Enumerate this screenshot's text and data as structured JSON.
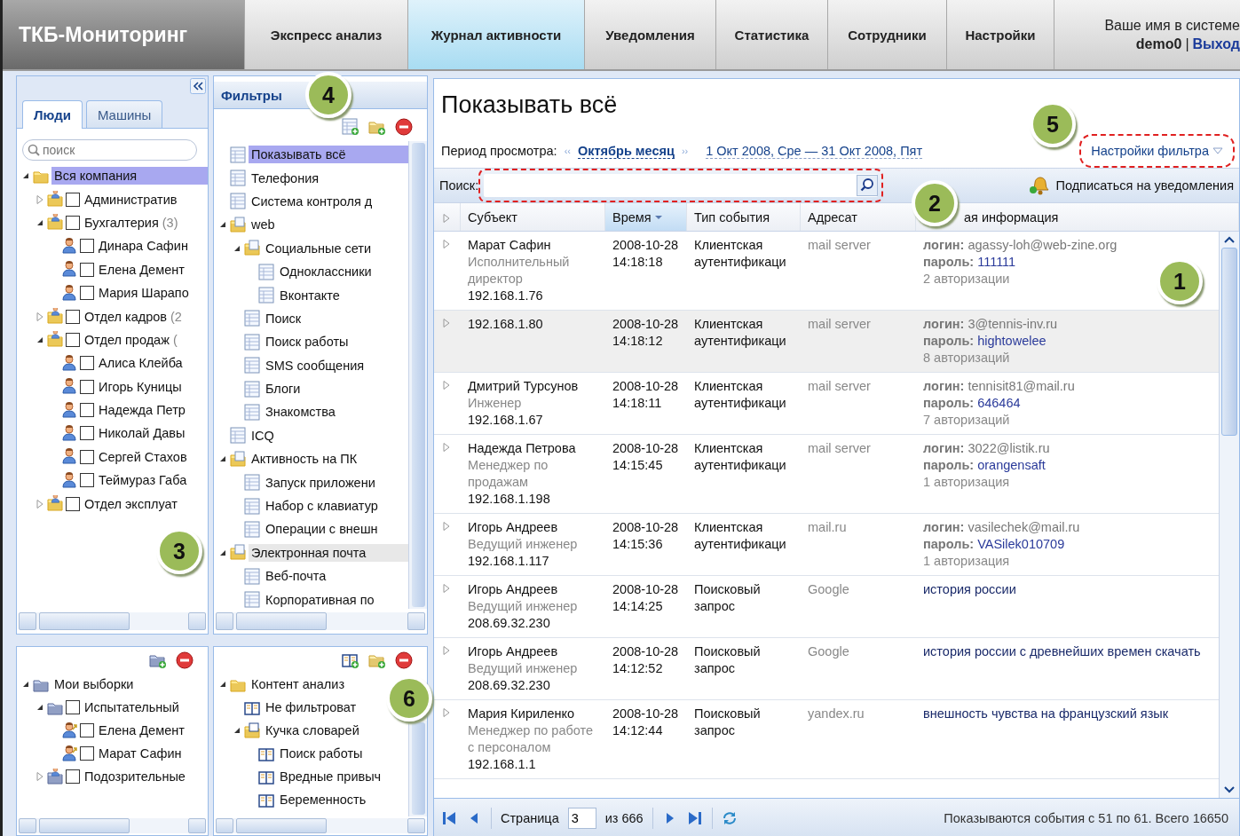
{
  "header": {
    "logo": "ТКБ-Мониторинг",
    "nav": [
      {
        "label": "Экспресс анализ",
        "selected": false
      },
      {
        "label": "Журнал активности",
        "selected": true
      },
      {
        "label": "Уведомления",
        "selected": false
      },
      {
        "label": "Статистика",
        "selected": false
      },
      {
        "label": "Сотрудники",
        "selected": false
      },
      {
        "label": "Настройки",
        "selected": false
      }
    ],
    "user_label": "Ваше имя в системе",
    "user_name": "demo0",
    "separator": "|",
    "logout": "Выход"
  },
  "people_panel": {
    "tabs": [
      {
        "label": "Люди",
        "selected": true
      },
      {
        "label": "Машины",
        "selected": false
      }
    ],
    "search": {
      "placeholder": "поиск"
    },
    "tree": [
      {
        "label": "Вся компания",
        "kind": "folder",
        "expanded": true,
        "selected": true,
        "children": [
          {
            "label": "Административ",
            "kind": "group",
            "expanded": false,
            "checked": false,
            "selected": false
          },
          {
            "label": "Бухгалтерия",
            "count": "(3)",
            "kind": "group",
            "expanded": true,
            "checked": false,
            "selected": false,
            "children": [
              {
                "label": "Динара Сафин",
                "kind": "person",
                "checked": false,
                "selected": false
              },
              {
                "label": "Елена Демент",
                "kind": "person",
                "checked": false,
                "selected": false
              },
              {
                "label": "Мария Шарапо",
                "kind": "person",
                "checked": false,
                "selected": false
              }
            ]
          },
          {
            "label": "Отдел кадров",
            "count": "(2",
            "kind": "group",
            "expanded": false,
            "checked": false,
            "selected": false
          },
          {
            "label": "Отдел продаж",
            "count": "(",
            "kind": "group",
            "expanded": true,
            "checked": false,
            "selected": false,
            "children": [
              {
                "label": "Алиса Клейба",
                "kind": "person",
                "checked": false,
                "selected": false
              },
              {
                "label": "Игорь Куницы",
                "kind": "person",
                "checked": false,
                "selected": false
              },
              {
                "label": "Надежда Петр",
                "kind": "person",
                "checked": false,
                "selected": false
              },
              {
                "label": "Николай Давы",
                "kind": "person",
                "checked": false,
                "selected": false
              },
              {
                "label": "Сергей Стахов",
                "kind": "person",
                "checked": false,
                "selected": false
              },
              {
                "label": "Теймураз Габа",
                "kind": "person",
                "checked": false,
                "selected": false
              }
            ]
          },
          {
            "label": "Отдел эксплуат",
            "kind": "group",
            "expanded": false,
            "checked": false,
            "selected": false
          }
        ]
      }
    ]
  },
  "selections_panel": {
    "toolbar": [
      {
        "kind": "add-group"
      },
      {
        "kind": "delete"
      }
    ],
    "tree": [
      {
        "label": "Мои выборки",
        "kind": "blue-folder",
        "expanded": true,
        "children": [
          {
            "label": "Испытательный",
            "kind": "blue-folder",
            "expanded": true,
            "checked": false,
            "children": [
              {
                "label": "Елена Демент",
                "kind": "person-link",
                "checked": false
              },
              {
                "label": "Марат Сафин",
                "kind": "person-link",
                "checked": false
              }
            ]
          },
          {
            "label": "Подозрительные",
            "kind": "blue-group",
            "expanded": false,
            "checked": false
          }
        ]
      }
    ]
  },
  "filters_panel": {
    "title": "Фильтры",
    "toolbar": [
      {
        "kind": "add-table"
      },
      {
        "kind": "add-folder"
      },
      {
        "kind": "delete"
      }
    ],
    "tree": [
      {
        "label": "Показывать всё",
        "kind": "table",
        "selected": true
      },
      {
        "label": "Телефония",
        "kind": "table",
        "selected": false
      },
      {
        "label": "Система контроля д",
        "kind": "table",
        "selected": false
      },
      {
        "label": "web",
        "kind": "table-folder",
        "expanded": true,
        "selected": false,
        "children": [
          {
            "label": "Социальные сети",
            "kind": "table-folder",
            "expanded": true,
            "selected": false,
            "children": [
              {
                "label": "Одноклассники",
                "kind": "table",
                "selected": false
              },
              {
                "label": "Вконтакте",
                "kind": "table",
                "selected": false
              }
            ]
          },
          {
            "label": "Поиск",
            "kind": "table",
            "selected": false
          },
          {
            "label": "Поиск работы",
            "kind": "table",
            "selected": false
          },
          {
            "label": "SMS сообщения",
            "kind": "table",
            "selected": false
          },
          {
            "label": "Блоги",
            "kind": "table",
            "selected": false
          },
          {
            "label": "Знакомства",
            "kind": "table",
            "selected": false
          }
        ]
      },
      {
        "label": "ICQ",
        "kind": "table",
        "selected": false
      },
      {
        "label": "Активность на ПК",
        "kind": "table-folder",
        "expanded": true,
        "selected": false,
        "children": [
          {
            "label": "Запуск приложени",
            "kind": "table",
            "selected": false
          },
          {
            "label": "Набор с клавиатур",
            "kind": "table",
            "selected": false
          },
          {
            "label": "Операции с внешн",
            "kind": "table",
            "selected": false
          }
        ]
      },
      {
        "label": "Электронная почта",
        "kind": "table-folder",
        "expanded": true,
        "selected": false,
        "hover": true,
        "children": [
          {
            "label": "Веб-почта",
            "kind": "table",
            "selected": false
          },
          {
            "label": "Корпоративная по",
            "kind": "table",
            "selected": false
          }
        ]
      }
    ]
  },
  "content_panel": {
    "toolbar": [
      {
        "kind": "add-book"
      },
      {
        "kind": "add-folder"
      },
      {
        "kind": "delete"
      }
    ],
    "tree": [
      {
        "label": "Контент анализ",
        "kind": "folder",
        "expanded": true,
        "children": [
          {
            "label": "Не фильтроват",
            "kind": "book"
          },
          {
            "label": "Кучка словарей",
            "kind": "book-folder",
            "expanded": true,
            "children": [
              {
                "label": "Поиск работы",
                "kind": "book"
              },
              {
                "label": "Вредные привыч",
                "kind": "book"
              },
              {
                "label": "Беременность",
                "kind": "book"
              }
            ]
          }
        ]
      }
    ]
  },
  "main": {
    "title": "Показывать всё",
    "period_label": "Период просмотра:",
    "period_prev": "‹‹",
    "period_value": "Октябрь месяц",
    "period_next": "››",
    "date_range": "1 Окт 2008, Сре — 31 Окт 2008, Пят",
    "filter_settings": "Настройки фильтра",
    "search_label": "Поиск:",
    "subscribe": "Подписаться на уведомления",
    "columns": [
      {
        "label": "Субъект",
        "sorted": false
      },
      {
        "label": "Время",
        "sorted": true
      },
      {
        "label": "Тип события",
        "sorted": false
      },
      {
        "label": "Адресат",
        "sorted": false
      },
      {
        "label": "ая информация",
        "sorted": false
      }
    ],
    "rows": [
      {
        "kind": "auth",
        "selected": false,
        "expanded": false,
        "subject": "Марат Сафин",
        "role": "Исполнительный директор",
        "ip": "192.168.1.76",
        "time": "2008-10-28 14:18:18",
        "event": "Клиентская аутентификаци",
        "recipient": "mail server",
        "login": "**логин:** agassy-loh@web-zine.org",
        "password": "**пароль:** 111111",
        "count": "2 авторизации"
      },
      {
        "kind": "auth",
        "selected": true,
        "expanded": false,
        "subject": "192.168.1.80",
        "time": "2008-10-28 14:18:12",
        "event": "Клиентская аутентификаци",
        "recipient": "mail server",
        "login": "**логин:** 3@tennis-inv.ru",
        "password": "**пароль:** hightowelee",
        "count": "8 авторизаций"
      },
      {
        "kind": "auth",
        "selected": false,
        "expanded": false,
        "subject": "Дмитрий Турсунов",
        "role": "Инженер",
        "ip": "192.168.1.67",
        "time": "2008-10-28 14:18:11",
        "event": "Клиентская аутентификаци",
        "recipient": "mail server",
        "login": "**логин:** tennisit81@mail.ru",
        "password": "**пароль:** 646464",
        "count": "7 авторизаций"
      },
      {
        "kind": "auth",
        "selected": false,
        "expanded": false,
        "subject": "Надежда Петрова",
        "role": "Менеджер по продажам",
        "ip": "192.168.1.198",
        "time": "2008-10-28 14:15:45",
        "event": "Клиентская аутентификаци",
        "recipient": "mail server",
        "login": "**логин:** 3022@listik.ru",
        "password": "**пароль:** orangensaft",
        "count": "1 авторизация"
      },
      {
        "kind": "auth",
        "selected": false,
        "expanded": false,
        "subject": "Игорь Андреев",
        "role": "Ведущий инженер",
        "ip": "192.168.1.117",
        "time": "2008-10-28 14:15:36",
        "event": "Клиентская аутентификаци",
        "recipient": "mail.ru",
        "login": "**логин:** vasilechek@mail.ru",
        "password": "**пароль:** VASilek010709",
        "count": "1 авторизация"
      },
      {
        "kind": "query",
        "selected": false,
        "expanded": false,
        "subject": "Игорь Андреев",
        "role": "Ведущий инженер",
        "ip": "208.69.32.230",
        "time": "2008-10-28 14:14:25",
        "event": "Поисковый запрос",
        "recipient": "Google",
        "query": "история россии"
      },
      {
        "kind": "query",
        "selected": false,
        "expanded": false,
        "subject": "Игорь Андреев",
        "role": "Ведущий инженер",
        "ip": "208.69.32.230",
        "time": "2008-10-28 14:12:52",
        "event": "Поисковый запрос",
        "recipient": "Google",
        "query": "история россии с древнейших времен скачать"
      },
      {
        "kind": "query",
        "selected": false,
        "expanded": false,
        "subject": "Мария Кириленко",
        "role": "Менеджер по работе с персоналом",
        "ip": "192.168.1.1",
        "time": "2008-10-28 14:12:44",
        "event": "Поисковый запрос",
        "recipient": "yandex.ru",
        "query": "внешность чувства на французский язык"
      }
    ],
    "pager": {
      "page_label": "Страница",
      "page": "3",
      "of": "из 666",
      "status": "Показываются события с 51 по 61. Всего 16650"
    }
  },
  "callouts": [
    {
      "label": "4"
    },
    {
      "label": "5"
    },
    {
      "label": "2"
    },
    {
      "label": "1"
    },
    {
      "label": "3"
    },
    {
      "label": "6"
    }
  ]
}
